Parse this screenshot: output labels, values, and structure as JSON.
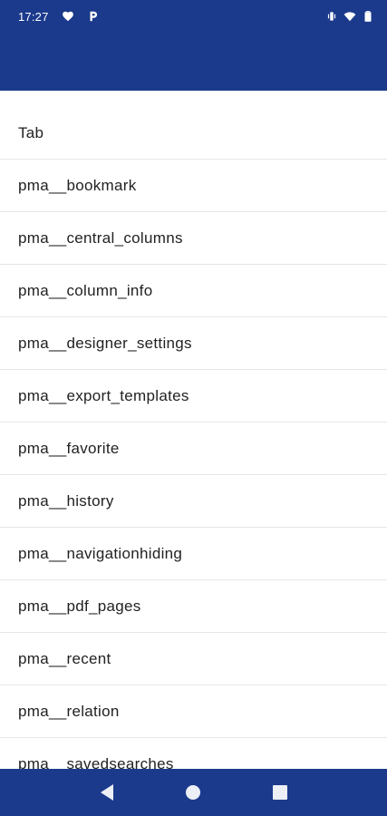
{
  "status_bar": {
    "time": "17:27",
    "icons_left": [
      "heart-notification-icon",
      "p-notification-icon"
    ],
    "icons_right": [
      "vibrate-icon",
      "wifi-icon",
      "battery-icon"
    ],
    "background": "#1b3a8c"
  },
  "app_bar": {
    "background": "#1b3a8c"
  },
  "tables": [
    "Tab",
    "pma__bookmark",
    "pma__central_columns",
    "pma__column_info",
    "pma__designer_settings",
    "pma__export_templates",
    "pma__favorite",
    "pma__history",
    "pma__navigationhiding",
    "pma__pdf_pages",
    "pma__recent",
    "pma__relation",
    "pma__savedsearches"
  ],
  "nav_bar": {
    "buttons": [
      "back-icon",
      "home-icon",
      "recents-icon"
    ]
  }
}
